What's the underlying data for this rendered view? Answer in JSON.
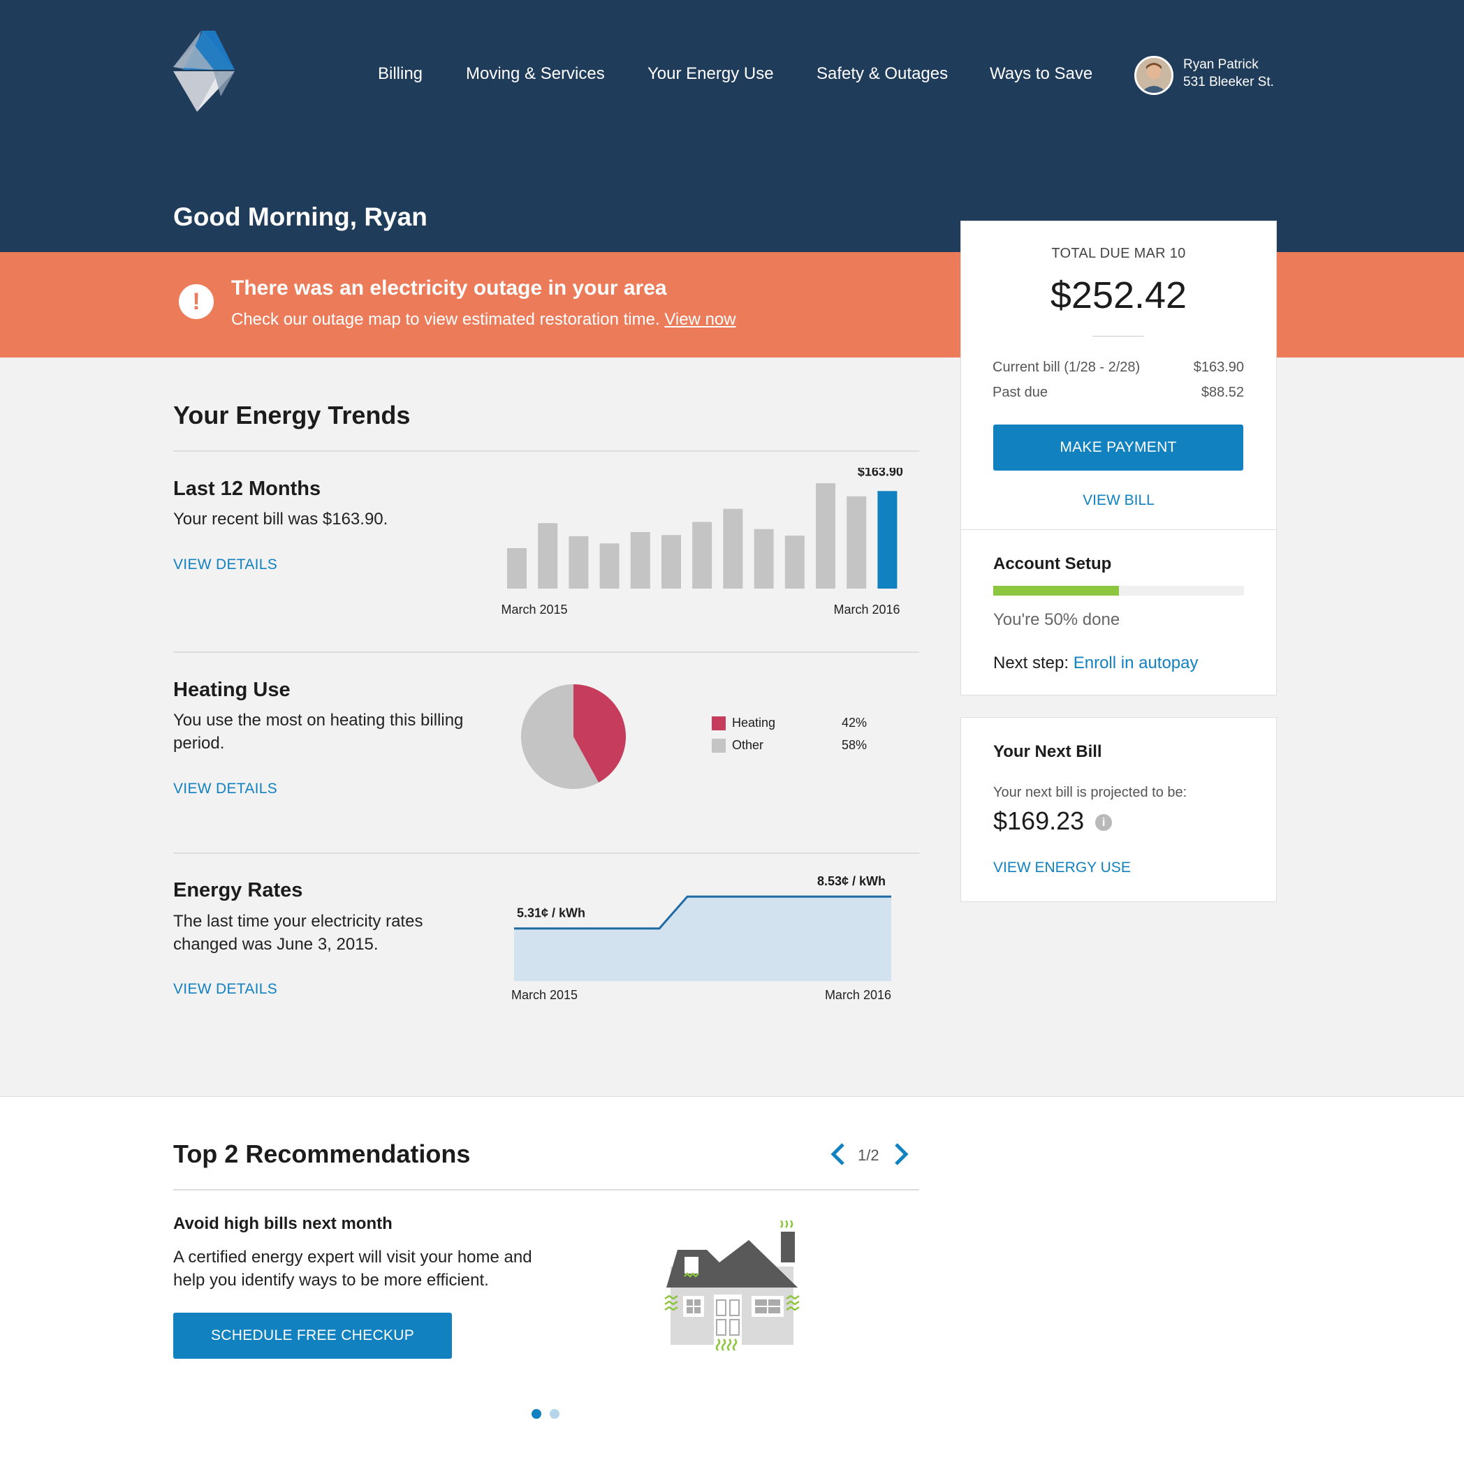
{
  "header": {
    "nav": [
      "Billing",
      "Moving & Services",
      "Your Energy Use",
      "Safety & Outages",
      "Ways to Save"
    ],
    "user": {
      "name": "Ryan Patrick",
      "address": "531 Bleeker St."
    },
    "greeting": "Good Morning, Ryan",
    "logo_icon": "diamond-mountain-logo",
    "avatar_icon": "user-avatar"
  },
  "alert": {
    "icon": "exclamation-icon",
    "title": "There was an electricity outage in your area",
    "message": "Check our outage map to view estimated restoration time.",
    "link": "View now"
  },
  "trends": {
    "title": "Your Energy Trends",
    "last12": {
      "title": "Last 12 Months",
      "text": "Your recent bill was $163.90.",
      "link": "VIEW DETAILS",
      "highlight_label": "$163.90",
      "x_start": "March 2015",
      "x_end": "March 2016"
    },
    "heating": {
      "title": "Heating Use",
      "text": "You use the most on heating this billing period.",
      "link": "VIEW DETAILS",
      "legend": [
        {
          "label": "Heating",
          "value": "42%"
        },
        {
          "label": "Other",
          "value": "58%"
        }
      ]
    },
    "rates": {
      "title": "Energy Rates",
      "text": "The last time your electricity rates changed was June 3, 2015.",
      "link": "VIEW DETAILS",
      "start_label": "5.31¢ / kWh",
      "end_label": "8.53¢ / kWh",
      "x_start": "March 2015",
      "x_end": "March 2016"
    }
  },
  "chart_data": [
    {
      "type": "bar",
      "categories": [
        "1",
        "2",
        "3",
        "4",
        "5",
        "6",
        "7",
        "8",
        "9",
        "10",
        "11",
        "12",
        "13"
      ],
      "values": [
        68,
        110,
        88,
        76,
        95,
        90,
        112,
        134,
        100,
        89,
        177,
        155,
        163.9
      ],
      "highlight_index": 12,
      "x_tick_labels": [
        "March 2015",
        "March 2016"
      ],
      "data_label": "$163.90",
      "colors": {
        "bar": "#c4c4c4",
        "highlight": "#1281bf"
      },
      "ylim": [
        0,
        190
      ]
    },
    {
      "type": "pie",
      "labels": [
        "Heating",
        "Other"
      ],
      "values": [
        42,
        58
      ],
      "colors": [
        "#c63c5d",
        "#c4c4c4"
      ]
    },
    {
      "type": "area",
      "x": [
        "March 2015",
        "June 2015",
        "March 2016"
      ],
      "y": [
        5.31,
        5.31,
        8.53
      ],
      "data_labels": [
        "5.31¢ / kWh",
        "8.53¢ / kWh"
      ],
      "ylim": [
        0,
        9.1
      ],
      "colors": {
        "line": "#1f6aa3",
        "fill": "#d2e3ef"
      }
    }
  ],
  "billing": {
    "label": "TOTAL DUE MAR 10",
    "amount": "$252.42",
    "rows": [
      {
        "label": "Current bill (1/28 - 2/28)",
        "value": "$163.90"
      },
      {
        "label": "Past due",
        "value": "$88.52"
      }
    ],
    "pay_button": "MAKE PAYMENT",
    "view_bill": "VIEW BILL"
  },
  "setup": {
    "title": "Account Setup",
    "progress": 0.5,
    "progress_text": "You're 50% done",
    "next_label": "Next step:",
    "next_link": "Enroll in autopay",
    "colors": {
      "fill": "#8cc63f",
      "track": "#f0f0f0"
    }
  },
  "next_bill": {
    "title": "Your Next Bill",
    "text": "Your next bill is projected to be:",
    "amount": "$169.23",
    "info_icon": "info-icon",
    "link": "VIEW ENERGY USE"
  },
  "recommendations": {
    "title": "Top 2 Recommendations",
    "pager": "1/2",
    "item": {
      "title": "Avoid high bills next month",
      "text": "A certified energy expert will visit your home and help you identify ways to be more efficient.",
      "button": "SCHEDULE FREE CHECKUP",
      "illustration": "house-heat-loss-illustration"
    },
    "dots": 2,
    "active_dot": 0
  },
  "colors": {
    "navy": "#203c5b",
    "alert": "#ec7b59",
    "accent": "#1281bf",
    "background": "#f2f2f2"
  }
}
